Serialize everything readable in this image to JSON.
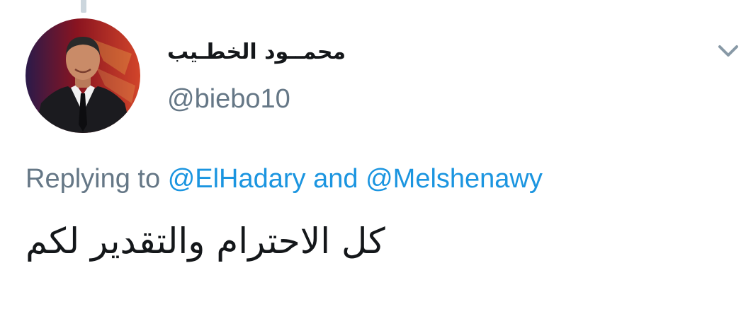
{
  "tweet": {
    "author": {
      "display_name": "محمــود الخطـيب",
      "handle": "@biebo10",
      "avatar_icon": "profile-photo"
    },
    "menu_icon": "chevron-down-icon",
    "reply": {
      "prefix": "Replying to",
      "mentions": [
        "@ElHadary",
        "@Melshenawy"
      ],
      "conjunction": "and"
    },
    "text": "كل الاحترام والتقدير لكم"
  },
  "colors": {
    "text_primary": "#14171a",
    "text_secondary": "#657786",
    "link": "#1b95e0",
    "thread_line": "#ccd6dd",
    "caret": "#8899a6"
  }
}
